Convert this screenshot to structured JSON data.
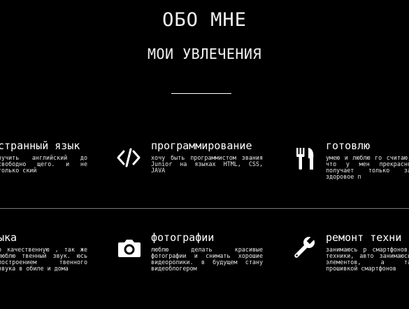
{
  "header": {
    "title": "ОБО МНЕ",
    "subtitle": "МОИ УВЛЕЧЕНИЯ"
  },
  "hobbies": [
    {
      "icon": "",
      "title": "странный язык",
      "text": "зучить английский до свободно щего. и не только ский"
    },
    {
      "icon": "code-icon",
      "title": "программирование",
      "text": "хочу быть программистом звания Junior на языках HTML, CSS, JAVA"
    },
    {
      "icon": "cutlery-icon",
      "title": "готовлю",
      "text": "умею и люблю го считаю, что у мен прекрасно получает только за здоровое п"
    },
    {
      "icon": "",
      "title": "ыка",
      "text": "о качественную , так же люблю твенный звук. юсь построением твенного звука в обиле и дома"
    },
    {
      "icon": "camera-icon",
      "title": "фотографии",
      "text": "люблю делать красивые фотографии и снимать хорошие видеоролики. в будущем стану видеоблогером"
    },
    {
      "icon": "wrench-icon",
      "title": "ремонт техни",
      "text": "занимаюсь р смартфонов, техники, авто занимаюсь элементов, а та прошивкой смартфонов"
    }
  ],
  "colors": {
    "background": "#000000",
    "text": "#ffffff",
    "divider": "#777777"
  }
}
